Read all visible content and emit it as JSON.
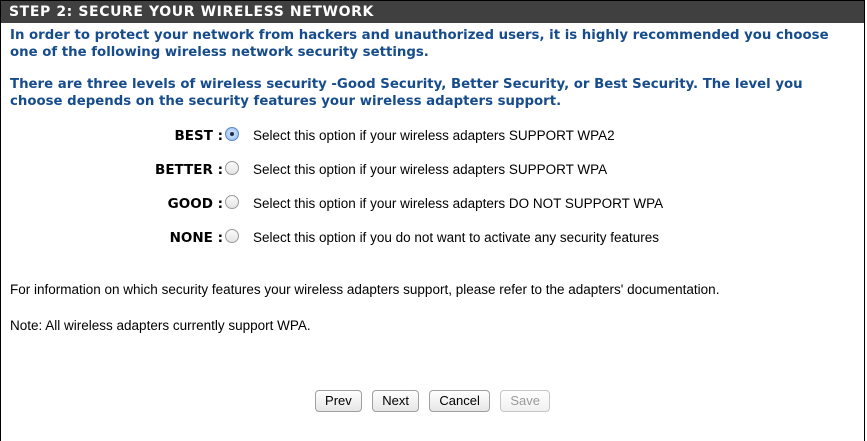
{
  "header": {
    "title": "STEP 2: SECURE YOUR WIRELESS NETWORK"
  },
  "intro": {
    "paragraph1": "In order to protect your network from hackers and unauthorized users, it is highly recommended you choose one of the following wireless network security settings.",
    "paragraph2": "There are three levels of wireless security -Good Security, Better Security, or Best Security. The level you choose depends on the security features your wireless adapters support."
  },
  "options": [
    {
      "label": "BEST :",
      "description": "Select this option if your wireless adapters SUPPORT WPA2",
      "checked": true
    },
    {
      "label": "BETTER :",
      "description": "Select this option if your wireless adapters SUPPORT WPA",
      "checked": false
    },
    {
      "label": "GOOD :",
      "description": "Select this option if your wireless adapters DO NOT SUPPORT WPA",
      "checked": false
    },
    {
      "label": "NONE :",
      "description": "Select this option if you do not want to activate any security features",
      "checked": false
    }
  ],
  "info_text": "For information on which security features your wireless adapters support, please refer to the adapters' documentation.",
  "note_text": "Note: All wireless adapters currently support WPA.",
  "buttons": {
    "prev": "Prev",
    "next": "Next",
    "cancel": "Cancel",
    "save": "Save"
  }
}
